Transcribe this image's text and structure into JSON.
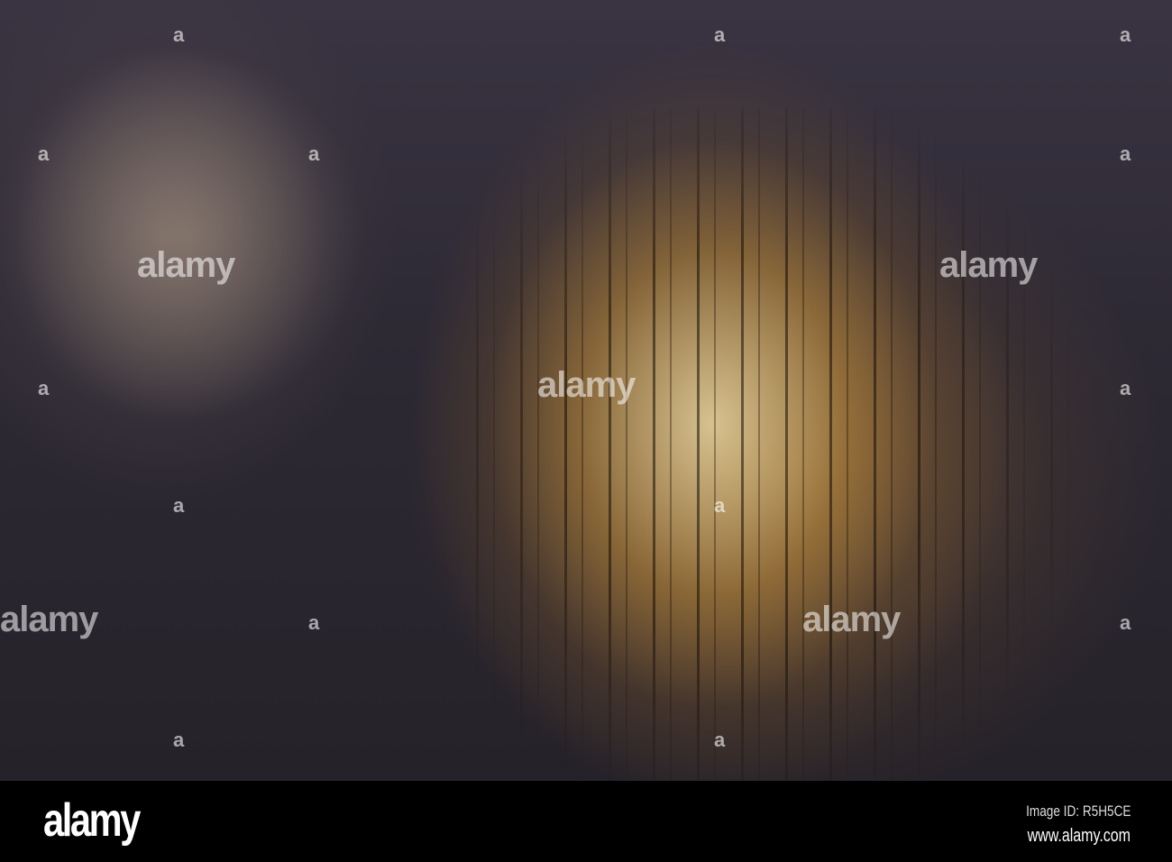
{
  "photo": {
    "watermark": "alamy",
    "watermark_mark": "a"
  },
  "footer": {
    "logo": "alamy",
    "image_id": "Image ID: R5H5CE",
    "website": "www.alamy.com"
  }
}
